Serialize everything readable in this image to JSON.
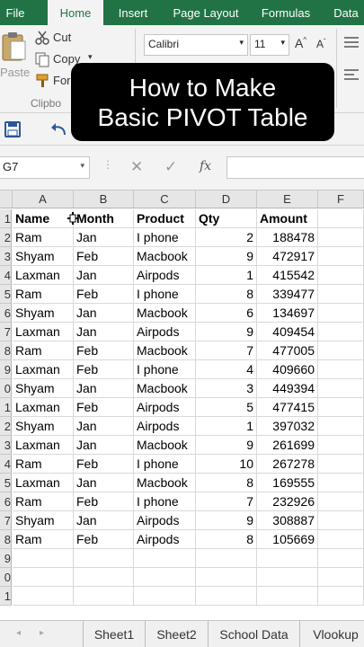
{
  "ribbon_tabs": [
    "File",
    "Home",
    "Insert",
    "Page Layout",
    "Formulas",
    "Data"
  ],
  "clipboard": {
    "paste_label": "Paste",
    "cut_label": "Cut",
    "copy_label": "Copy",
    "format_label": "For",
    "group_label": "Clipbo"
  },
  "font": {
    "name": "Calibri",
    "size": "11",
    "grow": "A",
    "shrink": "A"
  },
  "overlay": {
    "line1": "How to Make",
    "line2": "Basic PIVOT Table"
  },
  "formula_bar": {
    "name_box": "G7",
    "fx": "fx",
    "value": ""
  },
  "columns": [
    "A",
    "B",
    "C",
    "D",
    "E",
    "F"
  ],
  "row_numbers": [
    "1",
    "2",
    "3",
    "4",
    "5",
    "6",
    "7",
    "8",
    "9",
    "0",
    "1",
    "2",
    "3",
    "4",
    "5",
    "6",
    "7",
    "8",
    "9",
    "0",
    "1"
  ],
  "table": {
    "headers": [
      "Name",
      "Month",
      "Product",
      "Qty",
      "Amount"
    ],
    "rows": [
      [
        "Ram",
        "Jan",
        "I phone",
        "2",
        "188478"
      ],
      [
        "Shyam",
        "Feb",
        "Macbook",
        "9",
        "472917"
      ],
      [
        "Laxman",
        "Jan",
        "Airpods",
        "1",
        "415542"
      ],
      [
        "Ram",
        "Feb",
        "I phone",
        "8",
        "339477"
      ],
      [
        "Shyam",
        "Jan",
        "Macbook",
        "6",
        "134697"
      ],
      [
        "Laxman",
        "Jan",
        "Airpods",
        "9",
        "409454"
      ],
      [
        "Ram",
        "Feb",
        "Macbook",
        "7",
        "477005"
      ],
      [
        "Laxman",
        "Feb",
        "I phone",
        "4",
        "409660"
      ],
      [
        "Shyam",
        "Jan",
        "Macbook",
        "3",
        "449394"
      ],
      [
        "Laxman",
        "Feb",
        "Airpods",
        "5",
        "477415"
      ],
      [
        "Shyam",
        "Jan",
        "Airpods",
        "1",
        "397032"
      ],
      [
        "Laxman",
        "Jan",
        "Macbook",
        "9",
        "261699"
      ],
      [
        "Ram",
        "Feb",
        "I phone",
        "10",
        "267278"
      ],
      [
        "Laxman",
        "Jan",
        "Macbook",
        "8",
        "169555"
      ],
      [
        "Ram",
        "Feb",
        "I phone",
        "7",
        "232926"
      ],
      [
        "Shyam",
        "Jan",
        "Airpods",
        "9",
        "308887"
      ],
      [
        "Ram",
        "Feb",
        "Airpods",
        "8",
        "105669"
      ]
    ]
  },
  "sheets": [
    "Sheet1",
    "Sheet2",
    "School Data",
    "Vlookup"
  ],
  "colors": {
    "excel_green": "#217346",
    "grid_line": "#d9d9d9",
    "header_bg": "#e6e6e6"
  }
}
